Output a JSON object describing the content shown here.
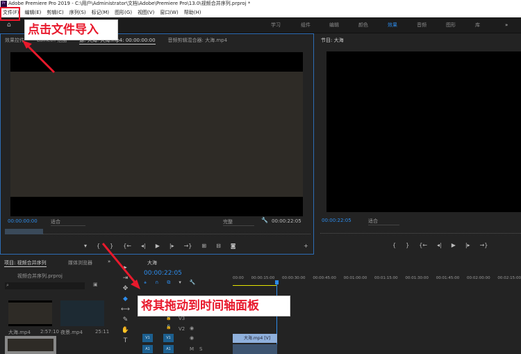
{
  "title": "Adobe Premiere Pro 2019 - C:\\用户\\Administrator\\文档\\Adobe\\Premiere Pro\\13.0\\视频合并序列.prproj *",
  "menu": [
    "文件(F)",
    "编辑(E)",
    "剪辑(C)",
    "序列(S)",
    "标记(M)",
    "图形(G)",
    "视图(V)",
    "窗口(W)",
    "帮助(H)"
  ],
  "workspaces": [
    "学习",
    "组件",
    "编辑",
    "颜色",
    "效果",
    "音频",
    "图形",
    "库"
  ],
  "active_workspace": "效果",
  "source_tabs": [
    "效果控件",
    "Lumetri 范围",
    "源: 大海: 大海.mp4: 00:00:00:00",
    "音频剪辑混合器: 大海.mp4"
  ],
  "source": {
    "timecode": "00:00:00:00",
    "fit": "适合",
    "quality": "完整",
    "duration": "00:00:22:05"
  },
  "program": {
    "tab": "节目: 大海",
    "timecode": "00:00:22:05",
    "fit": "适合"
  },
  "project": {
    "tab": "项目: 视频合并序列",
    "tab2": "媒体浏览器",
    "file": "视频合并序列.prproj",
    "items": [
      {
        "name": "大海.mp4",
        "duration": "2:57:10"
      },
      {
        "name": "夜景.mp4",
        "duration": "25:11"
      }
    ]
  },
  "timeline": {
    "tab": "大海",
    "timecode": "00:00:22:05",
    "ruler": [
      "00:00",
      "00:00:15:00",
      "00:00:30:00",
      "00:00:45:00",
      "00:01:00:00",
      "00:01:15:00",
      "00:01:30:00",
      "00:01:45:00",
      "00:02:00:00",
      "00:02:15:00"
    ],
    "tracks": [
      "V3",
      "V2",
      "V1",
      "A1"
    ],
    "clip": "大海.mp4 [V]",
    "mute": "M",
    "solo": "S"
  },
  "annotations": {
    "step1": "点击文件导入",
    "step2": "将其拖动到时间轴面板",
    "color": "#e8192c"
  },
  "colors": {
    "accent": "#2d8ceb"
  }
}
